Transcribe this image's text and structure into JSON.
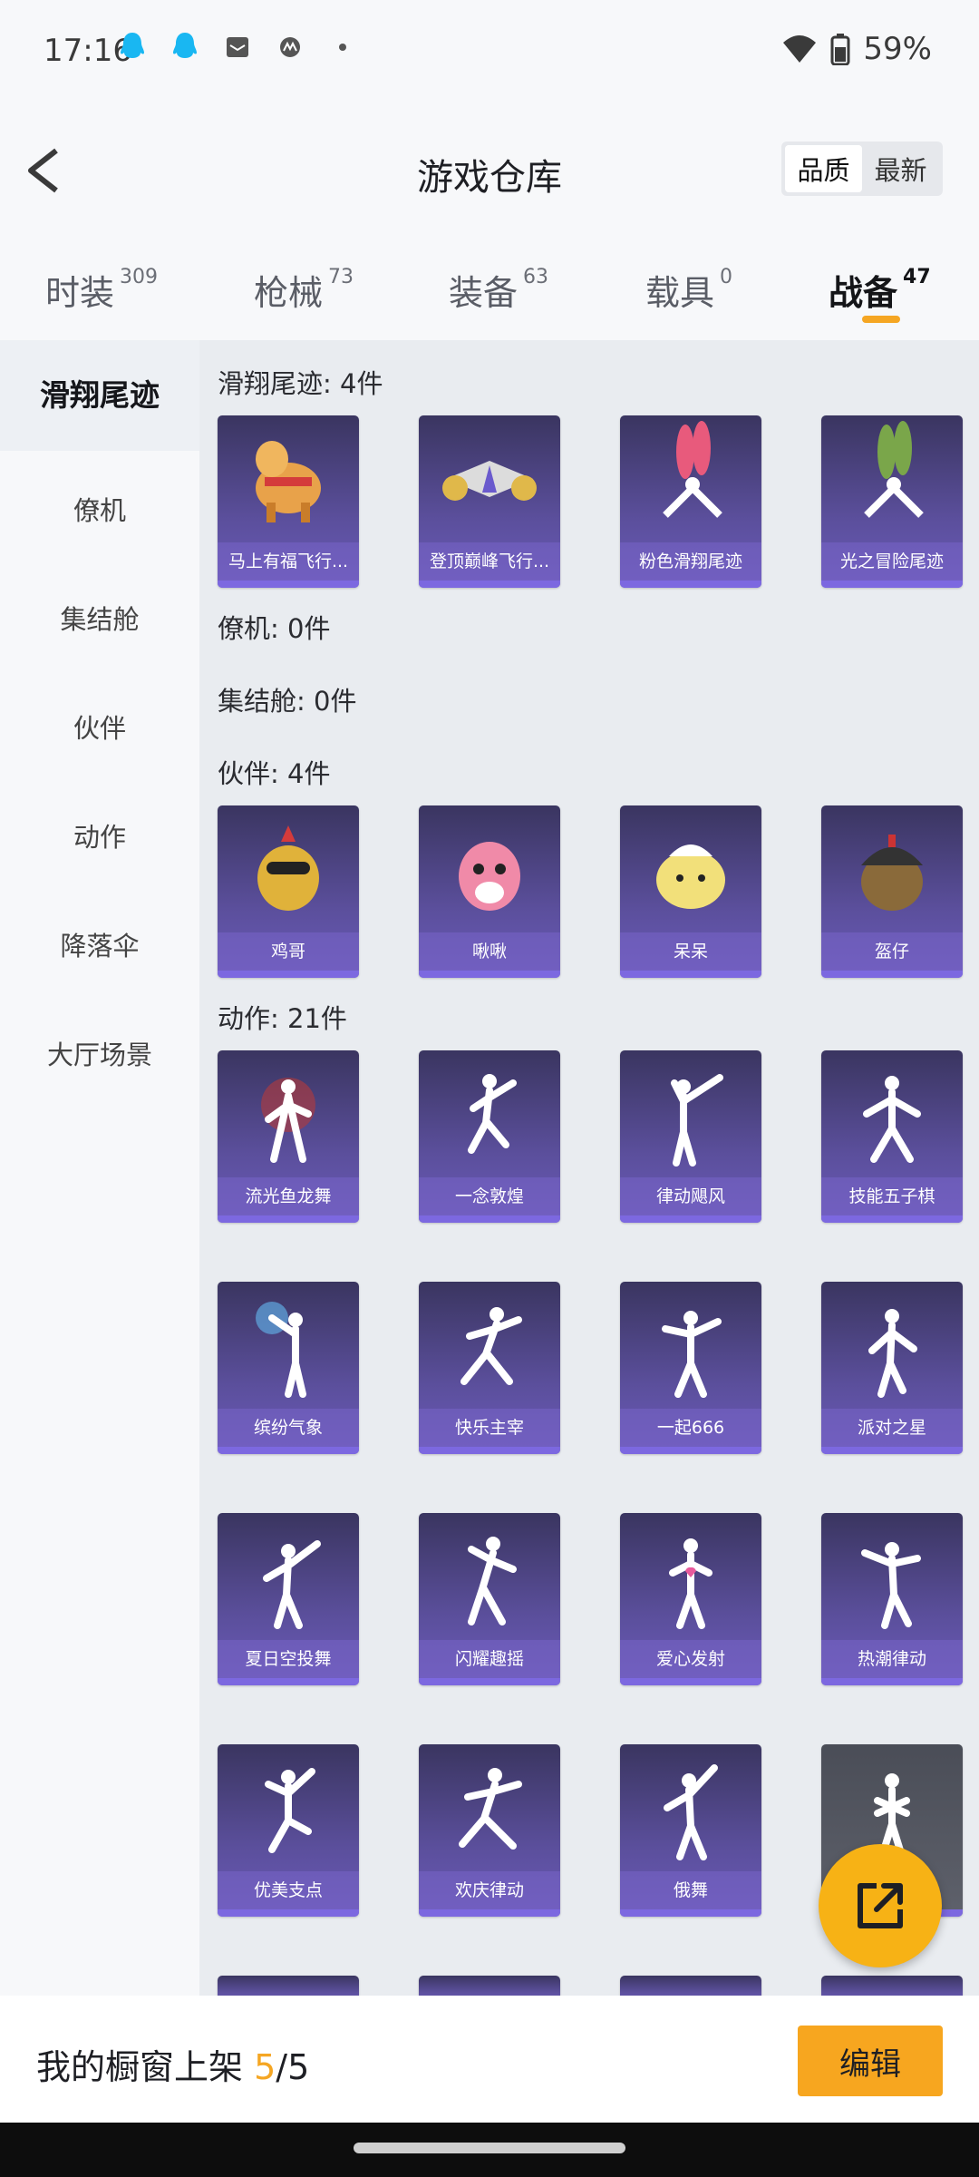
{
  "status": {
    "time": "17:16",
    "battery": "59%"
  },
  "header": {
    "title": "游戏仓库",
    "sort": [
      "品质",
      "最新"
    ]
  },
  "tabs": [
    {
      "label": "时装",
      "count": "309"
    },
    {
      "label": "枪械",
      "count": "73"
    },
    {
      "label": "装备",
      "count": "63"
    },
    {
      "label": "载具",
      "count": "0"
    },
    {
      "label": "战备",
      "count": "47"
    }
  ],
  "sidebar": [
    "滑翔尾迹",
    "僚机",
    "集结舱",
    "伙伴",
    "动作",
    "降落伞",
    "大厅场景"
  ],
  "sections": {
    "glide": {
      "title": "滑翔尾迹: 4件",
      "items": [
        "马上有福飞行...",
        "登顶巅峰飞行...",
        "粉色滑翔尾迹",
        "光之冒险尾迹"
      ]
    },
    "wingman": {
      "title": "僚机: 0件"
    },
    "pod": {
      "title": "集结舱: 0件"
    },
    "partner": {
      "title": "伙伴: 4件",
      "items": [
        "鸡哥",
        "啾啾",
        "呆呆",
        "盔仔"
      ]
    },
    "emote": {
      "title": "动作: 21件",
      "items": [
        "流光鱼龙舞",
        "一念敦煌",
        "律动飓风",
        "技能五子棋",
        "缤纷气象",
        "快乐主宰",
        "一起666",
        "派对之星",
        "夏日空投舞",
        "闪耀趣摇",
        "爱心发射",
        "热潮律动",
        "优美支点",
        "欢庆律动",
        "俄舞"
      ]
    }
  },
  "bottom": {
    "prefix": "我的橱窗上架 ",
    "count": "5",
    "suffix": "/5",
    "edit": "编辑"
  },
  "colors": {
    "accent": "#f5a623",
    "card": "#5b4f9c"
  }
}
